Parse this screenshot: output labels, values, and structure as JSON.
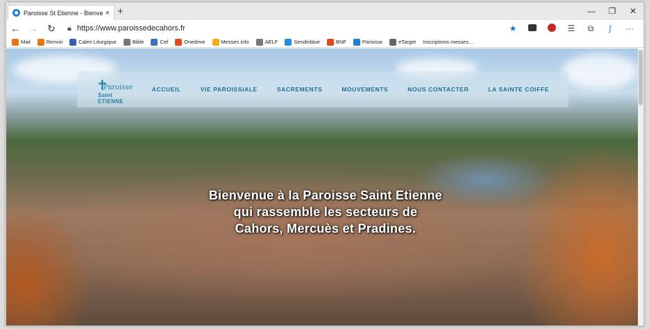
{
  "browser": {
    "tab_title": "Paroisse St Etienne - Bienvenue",
    "tab_close": "×",
    "new_tab": "+",
    "minimize": "—",
    "restore": "❐",
    "close": "✕",
    "back": "←",
    "forward": "→",
    "reload": "↻",
    "url": "https://www.paroissedecahors.fr",
    "menu": "···"
  },
  "bookmarks": [
    {
      "label": "Mail",
      "color": "#e8731a"
    },
    {
      "label": "Renvoi",
      "color": "#e8731a"
    },
    {
      "label": "Calen Liturgique",
      "color": "#3a5fb0"
    },
    {
      "label": "Bible",
      "color": "#777777"
    },
    {
      "label": "Cef",
      "color": "#3a72c0"
    },
    {
      "label": "Onedrive",
      "color": "#e24a1a"
    },
    {
      "label": "Messes info",
      "color": "#f0b020"
    },
    {
      "label": "AELF",
      "color": "#777777"
    },
    {
      "label": "Sendinblue",
      "color": "#2d8ad8"
    },
    {
      "label": "BNF",
      "color": "#e24a1a"
    },
    {
      "label": "Paroisse",
      "color": "#1f7fd0"
    },
    {
      "label": "eTarget",
      "color": "#666666"
    },
    {
      "label": "Inscriptions messes...",
      "color": ""
    }
  ],
  "site": {
    "logo_line1": "Paroisse",
    "logo_line2": "Saint ETIENNE",
    "menu": [
      "ACCUEIL",
      "VIE PAROISSIALE",
      "SACREMENTS",
      "MOUVEMENTS",
      "NOUS CONTACTER",
      "LA SAINTE COIFFE"
    ],
    "hero": [
      "Bienvenue à la Paroisse Saint Etienne",
      "qui rassemble les secteurs de",
      "Cahors, Mercuès et Pradines."
    ]
  }
}
